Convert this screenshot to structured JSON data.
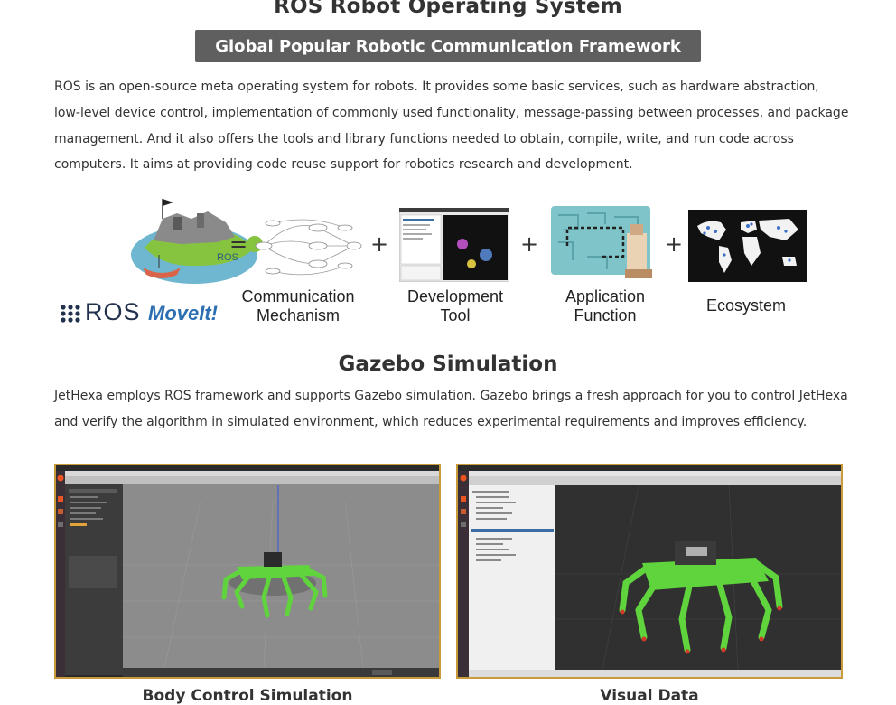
{
  "header": {
    "title": "ROS Robot Operating System",
    "subtitle": "Global Popular Robotic Communication Framework"
  },
  "intro": {
    "text": "ROS is an open-source meta operating system for robots. It provides some basic services, such as hardware abstraction, low-level device control, implementation of commonly used functionality, message-passing between processes, and package management. And it also offers the tools and library functions needed to obtain, compile, write, and run code across computers. It aims at providing code reuse support for robotics research and development."
  },
  "ros_equation": {
    "logo_ros": "ROS",
    "logo_moveit": "MoveIt!",
    "equals": "=",
    "plus": "+",
    "items": [
      {
        "label": "Communication\nMechanism"
      },
      {
        "label": "Development\nTool"
      },
      {
        "label": "Application\nFunction"
      },
      {
        "label": "Ecosystem"
      }
    ]
  },
  "gazebo": {
    "title": "Gazebo Simulation",
    "text": "JetHexa employs ROS framework and supports Gazebo simulation. Gazebo brings a fresh approach for you to control JetHexa and verify the algorithm in simulated environment, which reduces experimental requirements and improves efficiency."
  },
  "screenshots": [
    {
      "caption": "Body Control Simulation"
    },
    {
      "caption": "Visual Data"
    }
  ],
  "colors": {
    "badge_bg": "#5f5f5f",
    "robot_green": "#5fd43c",
    "frame_border": "#c89a3a",
    "ubuntu_orange": "#e95420"
  }
}
